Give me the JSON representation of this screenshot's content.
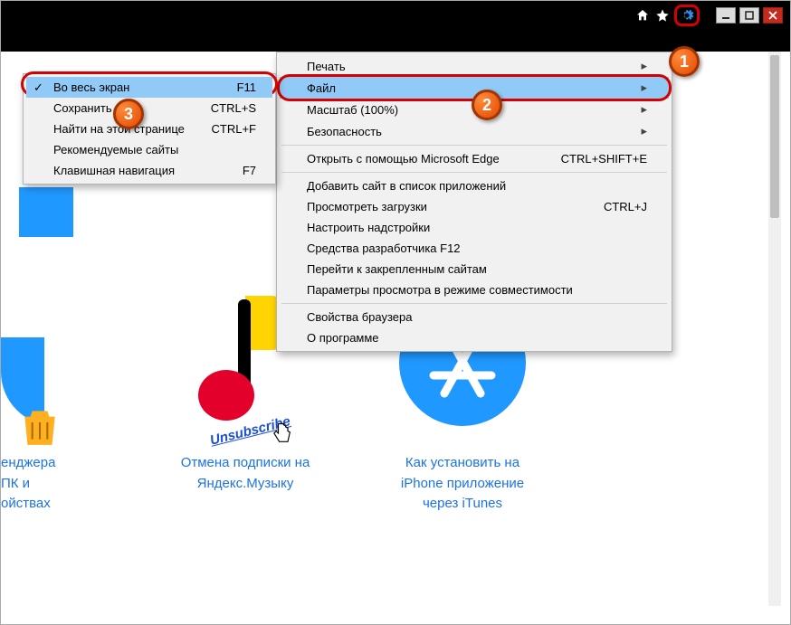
{
  "menu": {
    "items": [
      {
        "label": "Печать",
        "hasSubmenu": true
      },
      {
        "label": "Файл",
        "hasSubmenu": true,
        "highlighted": true,
        "redOutline": true
      },
      {
        "label": "Масштаб (100%)",
        "hasSubmenu": true
      },
      {
        "label": "Безопасность",
        "hasSubmenu": true
      },
      "sep",
      {
        "label": "Открыть с помощью Microsoft Edge",
        "shortcut": "CTRL+SHIFT+E"
      },
      "sep",
      {
        "label": "Добавить сайт в список приложений"
      },
      {
        "label": "Просмотреть загрузки",
        "shortcut": "CTRL+J"
      },
      {
        "label": "Настроить надстройки"
      },
      {
        "label": "Средства разработчика F12"
      },
      {
        "label": "Перейти к закрепленным сайтам"
      },
      {
        "label": "Параметры просмотра в режиме совместимости"
      },
      "sep",
      {
        "label": "Свойства браузера"
      },
      {
        "label": "О программе"
      }
    ]
  },
  "submenu": {
    "items": [
      {
        "label": "Во весь экран",
        "shortcut": "F11",
        "checked": true,
        "highlighted": true,
        "redOutline": true
      },
      {
        "label": "Сохранить как...",
        "shortcut": "CTRL+S"
      },
      {
        "label": "Найти на этой странице",
        "shortcut": "CTRL+F"
      },
      {
        "label": "Рекомендуемые сайты"
      },
      {
        "label": "Клавишная навигация",
        "shortcut": "F7"
      }
    ]
  },
  "cards": [
    {
      "title": "енджера\nПК и\nойствах"
    },
    {
      "title": "Отмена подписки на\nЯндекс.Музыку",
      "unsub": "Unsubscribe"
    },
    {
      "title": "Как установить на\niPhone приложение\nчерез iTunes"
    }
  ],
  "badges": {
    "one": "1",
    "two": "2",
    "three": "3"
  }
}
